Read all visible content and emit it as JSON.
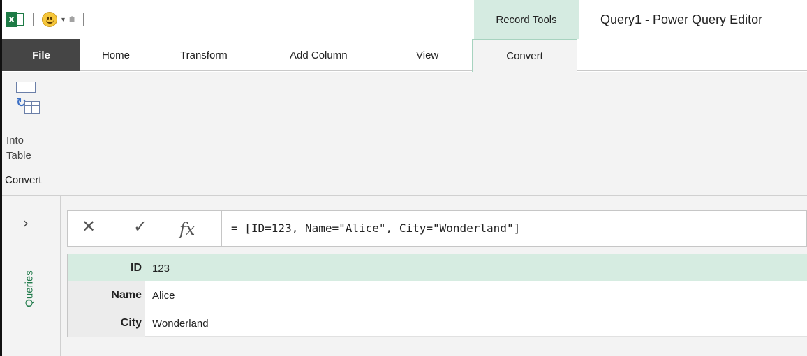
{
  "app": {
    "window_title": "Query1 - Power Query Editor",
    "contextual_group": "Record Tools"
  },
  "tabs": {
    "file": "File",
    "items": [
      "Home",
      "Transform",
      "Add Column",
      "View"
    ],
    "active": "Convert"
  },
  "ribbon": {
    "into_table_line1": "Into",
    "into_table_line2": "Table",
    "group_label": "Convert"
  },
  "queries_pane": {
    "label": "Queries",
    "expand_glyph": "›"
  },
  "formula_bar": {
    "cancel_glyph": "✕",
    "enter_glyph": "✓",
    "fx_label": "fx",
    "formula": "= [ID=123, Name=\"Alice\", City=\"Wonderland\"]"
  },
  "record": [
    {
      "field": "ID",
      "value": "123"
    },
    {
      "field": "Name",
      "value": "Alice"
    },
    {
      "field": "City",
      "value": "Wonderland"
    }
  ],
  "icons": [
    "excel-logo-icon",
    "smiley-icon",
    "into-table-icon",
    "chevron-right-icon"
  ],
  "colors": {
    "file_tab": "#454545",
    "contextual_tab": "#d5ebe1",
    "selected_row": "#d6ece1",
    "queries_text": "#1f7a4a"
  }
}
